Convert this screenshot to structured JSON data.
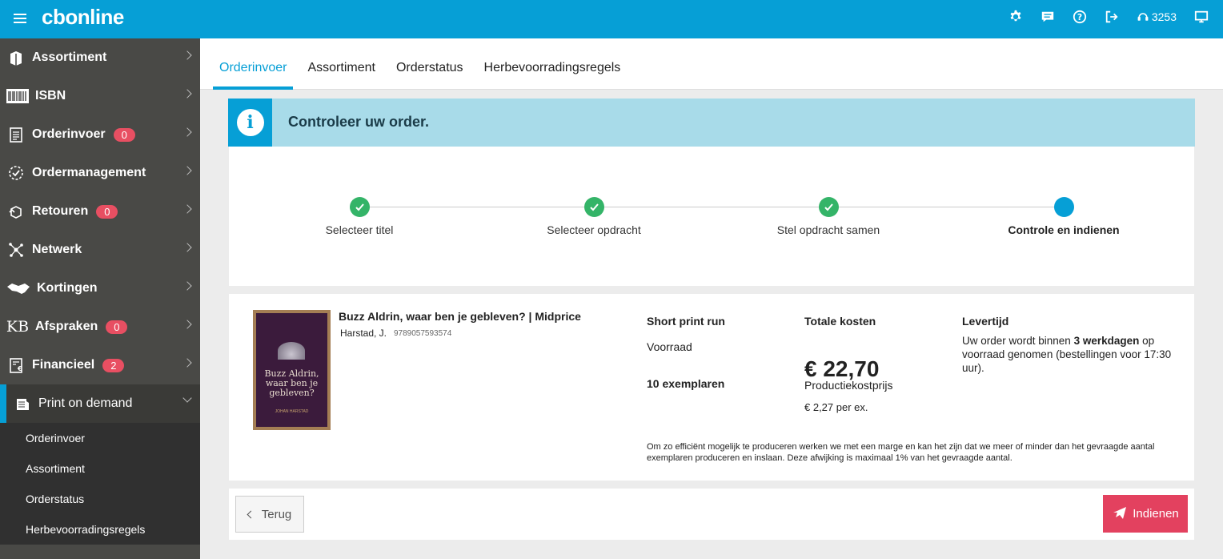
{
  "brand": {
    "part1": "cb",
    "part2": "online"
  },
  "topbar": {
    "support_number": "3253"
  },
  "sidebar": {
    "items": [
      {
        "label": "Assortiment",
        "badge": null
      },
      {
        "label": "ISBN",
        "badge": null
      },
      {
        "label": "Orderinvoer",
        "badge": "0"
      },
      {
        "label": "Ordermanagement",
        "badge": null
      },
      {
        "label": "Retouren",
        "badge": "0"
      },
      {
        "label": "Netwerk",
        "badge": null
      },
      {
        "label": "Kortingen",
        "badge": null
      },
      {
        "label": "Afspraken",
        "badge": "0"
      },
      {
        "label": "Financieel",
        "badge": "2"
      },
      {
        "label": "Print on demand",
        "badge": null
      }
    ],
    "subitems": [
      "Orderinvoer",
      "Assortiment",
      "Orderstatus",
      "Herbevoorradingsregels"
    ]
  },
  "tabs": [
    "Orderinvoer",
    "Assortiment",
    "Orderstatus",
    "Herbevoorradingsregels"
  ],
  "info": {
    "text": "Controleer uw order."
  },
  "steps": [
    "Selecteer titel",
    "Selecteer opdracht",
    "Stel opdracht samen",
    "Controle en indienen"
  ],
  "book": {
    "cover_title": "Buzz Aldrin, waar ben je gebleven?",
    "cover_author": "JOHAN HARSTAD",
    "title": "Buzz Aldrin, waar ben je gebleven? | Midprice",
    "author": "Harstad, J.",
    "isbn": "9789057593574"
  },
  "order": {
    "type_heading": "Short print run",
    "type_value": "Voorraad",
    "quantity": "10 exemplaren",
    "cost_heading": "Totale kosten",
    "total": "€ 22,70",
    "unit_heading": "Productiekostprijs",
    "unit_price": "€ 2,27 per ex.",
    "delivery_heading": "Levertijd",
    "delivery_pre": "Uw order wordt binnen ",
    "delivery_bold": "3 werkdagen",
    "delivery_post": " op voorraad genomen (bestellingen voor 17:30 uur).",
    "note": "Om zo efficiënt mogelijk te produceren werken we met een marge en kan het zijn dat we meer of minder dan het gevraagde aantal exemplaren produceren en inslaan. Deze afwijking is maximaal 1% van het gevraagde aantal."
  },
  "actions": {
    "back": "Terug",
    "submit": "Indienen"
  },
  "colors": {
    "primary": "#069fd6",
    "danger": "#e3415f",
    "success": "#34b468",
    "sidebar": "#494946"
  }
}
